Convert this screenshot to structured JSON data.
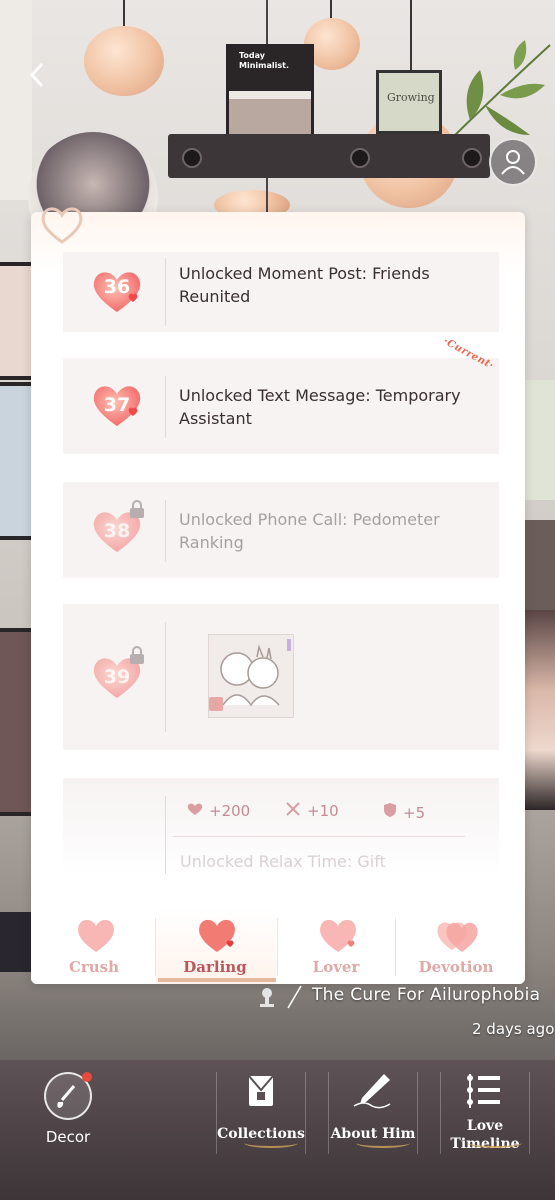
{
  "cards": [
    {
      "level": "36",
      "title": "Unlocked Moment Post: Friends Reunited",
      "locked": false
    },
    {
      "level": "37",
      "title": "Unlocked Text Message: Temporary Assistant",
      "locked": false,
      "tag": "·Current·"
    },
    {
      "level": "38",
      "title": "Unlocked Phone Call: Pedometer Ranking",
      "locked": true
    },
    {
      "level": "39",
      "title": "",
      "locked": true,
      "has_image": true
    }
  ],
  "rewards": {
    "items": [
      {
        "icon": "heart-icon",
        "value": "+200"
      },
      {
        "icon": "crossed-swords-icon",
        "value": "+10"
      },
      {
        "icon": "shield-icon",
        "value": "+5"
      }
    ],
    "faded_title": "Unlocked Relax Time: Gift"
  },
  "tabs": [
    {
      "label": "Crush",
      "active": false
    },
    {
      "label": "Darling",
      "active": true
    },
    {
      "label": "Lover",
      "active": false
    },
    {
      "label": "Devotion",
      "active": false
    }
  ],
  "story": {
    "title": "The Cure For Ailurophobia",
    "time": "2 days ago"
  },
  "scene": {
    "poster_line1": "Today",
    "poster_line2": "Minimalist.",
    "sign_text": "Growing"
  },
  "bottom_nav": {
    "decor": "Decor",
    "collections": "Collections",
    "about_him": "About Him",
    "love_timeline_1": "Love",
    "love_timeline_2": "Timeline"
  },
  "colors": {
    "accent": "#b9585a",
    "heart": "#f26b6b",
    "current_tag": "#e8664c"
  }
}
